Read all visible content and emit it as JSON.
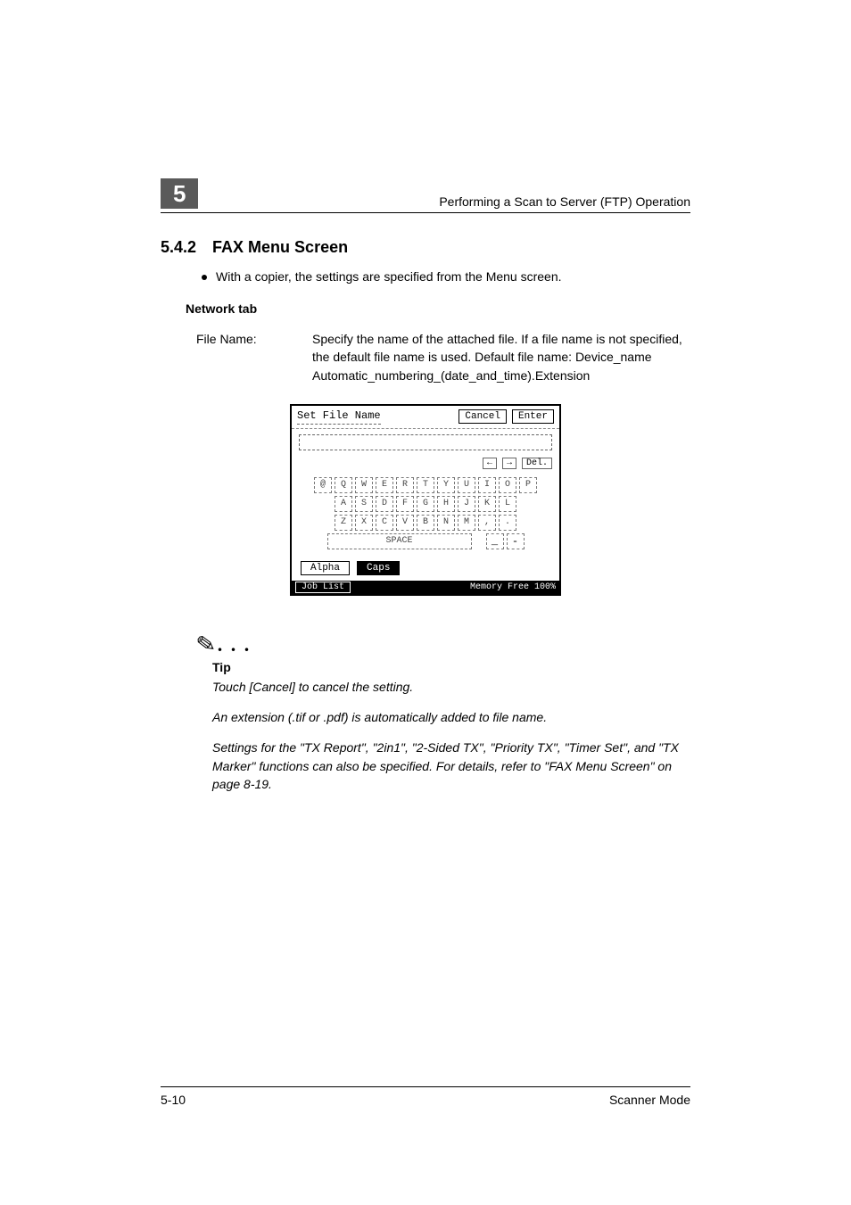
{
  "header": {
    "chapter": "5",
    "running_title": "Performing a Scan to Server (FTP) Operation"
  },
  "section": {
    "number": "5.4.2",
    "title": "FAX Menu Screen"
  },
  "bullet": "With a copier, the settings are specified from the Menu screen.",
  "network_tab": {
    "heading": "Network tab",
    "row_label": "File Name:",
    "row_body": "Specify the name of the attached file. If a file name is not specified, the default file name is used. Default file name: Device_name Automatic_numbering_(date_and_time).Extension"
  },
  "screenshot": {
    "title": "Set File Name",
    "cancel": "Cancel",
    "enter": "Enter",
    "arrow_left": "←",
    "arrow_right": "→",
    "del": "Del.",
    "rows": {
      "r1": [
        "@",
        "Q",
        "W",
        "E",
        "R",
        "T",
        "Y",
        "U",
        "I",
        "O",
        "P"
      ],
      "r2": [
        "A",
        "S",
        "D",
        "F",
        "G",
        "H",
        "J",
        "K",
        "L"
      ],
      "r3": [
        "Z",
        "X",
        "C",
        "V",
        "B",
        "N",
        "M",
        ",",
        "."
      ]
    },
    "space": "SPACE",
    "sq1": "_",
    "sq2": "-",
    "alpha": "Alpha",
    "caps": "Caps",
    "joblist": "Job List",
    "memory": "Memory Free 100%"
  },
  "tip": {
    "label": "Tip",
    "p1": "Touch [Cancel] to cancel the setting.",
    "p2": "An extension (.tif or .pdf) is automatically added to file name.",
    "p3": "Settings for the \"TX Report\", \"2in1\", \"2-Sided TX\", \"Priority TX\", \"Timer Set\", and \"TX Marker\" functions can also be specified. For details, refer to \"FAX Menu Screen\" on page 8-19."
  },
  "footer": {
    "page": "5-10",
    "doc": "Scanner Mode"
  }
}
